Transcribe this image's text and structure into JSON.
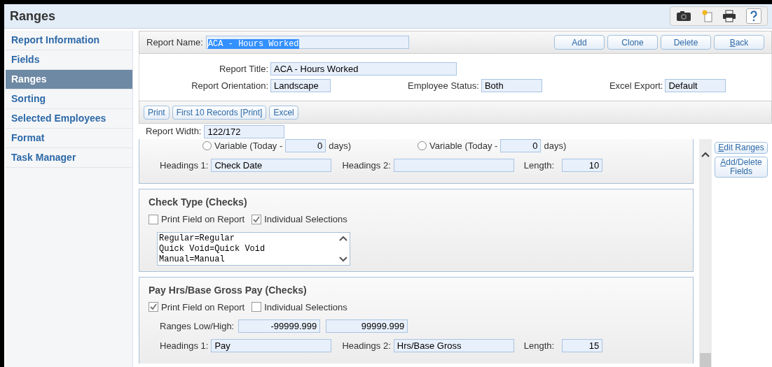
{
  "window": {
    "title": "Ranges"
  },
  "sidebar": {
    "items": [
      {
        "label": "Report Information",
        "selected": false
      },
      {
        "label": "Fields",
        "selected": false
      },
      {
        "label": "Ranges",
        "selected": true
      },
      {
        "label": "Sorting",
        "selected": false
      },
      {
        "label": "Selected Employees",
        "selected": false
      },
      {
        "label": "Format",
        "selected": false
      },
      {
        "label": "Task Manager",
        "selected": false
      }
    ]
  },
  "report_name": {
    "label": "Report Name:",
    "value": "ACA - Hours Worked"
  },
  "actions": [
    {
      "label": "Add",
      "hotkey": false
    },
    {
      "label": "Clone",
      "hotkey": false
    },
    {
      "label": "Delete",
      "hotkey": false
    },
    {
      "label": "Back",
      "hotkey": true
    }
  ],
  "info": {
    "report_title": {
      "label": "Report Title:",
      "value": "ACA - Hours Worked"
    },
    "orientation": {
      "label": "Report Orientation:",
      "value": "Landscape"
    },
    "employee_status": {
      "label": "Employee Status:",
      "value": "Both"
    },
    "excel_export": {
      "label": "Excel Export:",
      "value": "Default"
    }
  },
  "print_buttons": [
    "Print",
    "First 10 Records [Print]",
    "Excel"
  ],
  "report_width": {
    "label": "Report Width:",
    "value": "122/172"
  },
  "side_buttons": [
    {
      "label": "Edit Ranges",
      "hotkey": true
    },
    {
      "label": "Add/Delete Fields",
      "hotkey": true
    }
  ],
  "sections": [
    {
      "kind": "date",
      "variables": [
        {
          "label": "Variable (Today -",
          "value": "0",
          "unit": "days)",
          "selected": false
        },
        {
          "label": "Variable (Today -",
          "value": "0",
          "unit": "days)",
          "selected": false
        }
      ],
      "headings1": {
        "label": "Headings 1:",
        "value": "Check Date"
      },
      "headings2": {
        "label": "Headings 2:"
      },
      "length": {
        "label": "Length:",
        "value": "10"
      }
    },
    {
      "kind": "list",
      "title": "Check Type (Checks)",
      "print_field": {
        "label": "Print Field on Report",
        "checked": false
      },
      "individual": {
        "label": "Individual Selections",
        "checked": true
      },
      "options": [
        "Regular=Regular",
        "Quick Void=Quick Void",
        "Manual=Manual"
      ]
    },
    {
      "kind": "range",
      "title": "Pay Hrs/Base Gross Pay (Checks)",
      "print_field": {
        "label": "Print Field on Report",
        "checked": true
      },
      "individual": {
        "label": "Individual Selections",
        "checked": false
      },
      "ranges": {
        "label": "Ranges Low/High:",
        "low": "-99999.999",
        "high": "99999.999"
      },
      "headings1": {
        "label": "Headings 1:",
        "value": "Pay"
      },
      "headings2": {
        "label": "Headings 2:",
        "value": "Hrs/Base Gross"
      },
      "length": {
        "label": "Length:",
        "value": "15"
      }
    }
  ]
}
